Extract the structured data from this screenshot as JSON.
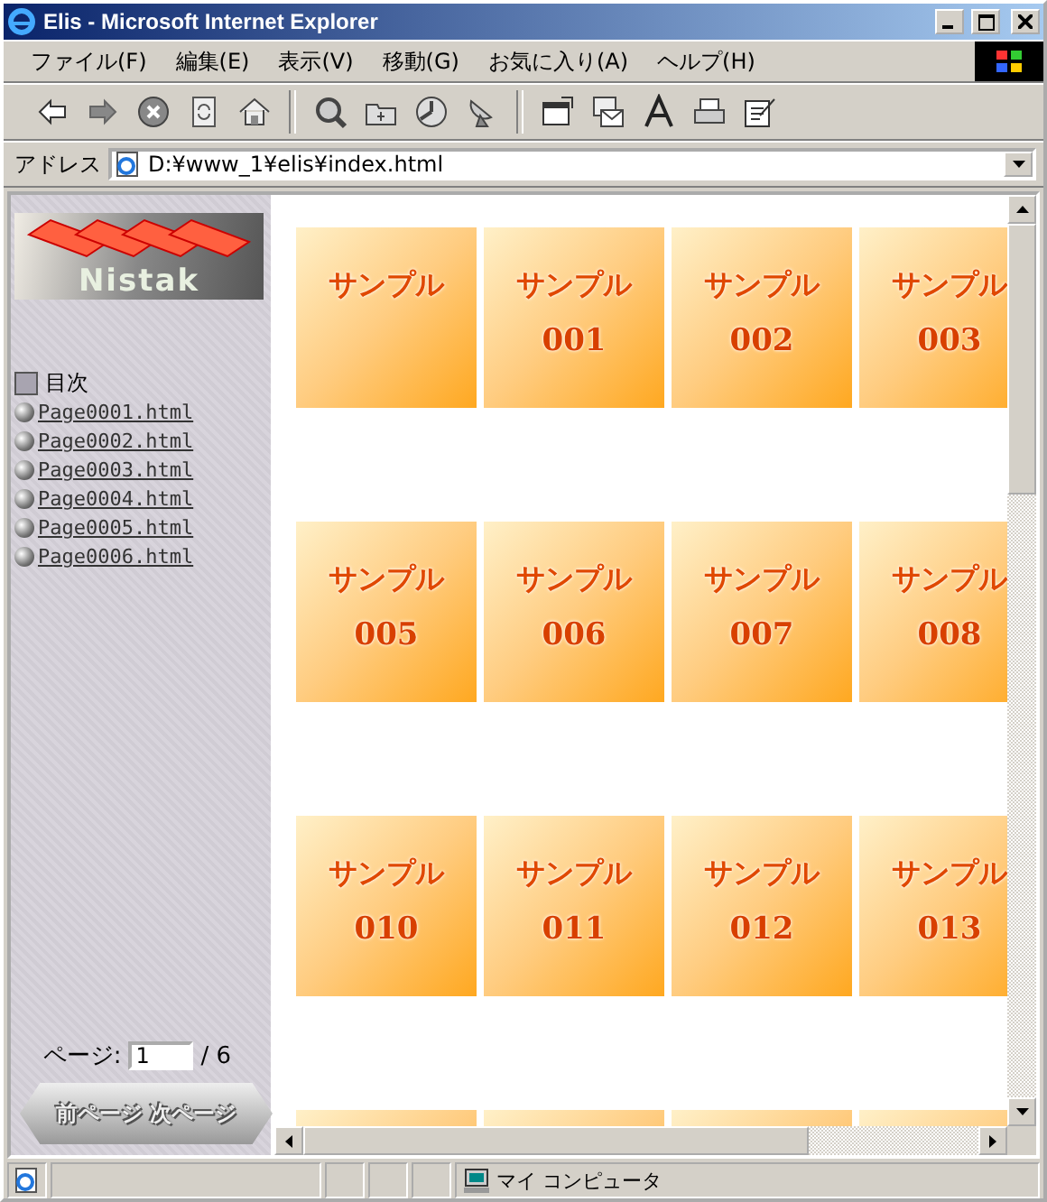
{
  "window": {
    "title": "Elis - Microsoft Internet Explorer"
  },
  "menu": [
    "ファイル(F)",
    "編集(E)",
    "表示(V)",
    "移動(G)",
    "お気に入り(A)",
    "ヘルプ(H)"
  ],
  "address": {
    "label": "アドレス",
    "value": "D:¥www_1¥elis¥index.html"
  },
  "sidebar": {
    "logo": "Nistak",
    "toc_title": "目次",
    "links": [
      "Page0001.html",
      "Page0002.html",
      "Page0003.html",
      "Page0004.html",
      "Page0005.html",
      "Page0006.html"
    ],
    "pager": {
      "label": "ページ:",
      "value": "1",
      "total": "/ 6",
      "prev": "前ページ",
      "next": "次ページ"
    }
  },
  "tiles": [
    {
      "kind": "sample",
      "title": "サンプル"
    },
    {
      "kind": "sample",
      "title": "サンプル",
      "number": "001"
    },
    {
      "kind": "sample",
      "title": "サンプル",
      "number": "002"
    },
    {
      "kind": "sample",
      "title": "サンプル",
      "number": "003"
    },
    {
      "kind": "sample",
      "title": "サンプル",
      "number": "005"
    },
    {
      "kind": "sample",
      "title": "サンプル",
      "number": "006"
    },
    {
      "kind": "sample",
      "title": "サンプル",
      "number": "007"
    },
    {
      "kind": "sample",
      "title": "サンプル",
      "number": "008"
    },
    {
      "kind": "sample",
      "title": "サンプル",
      "number": "010"
    },
    {
      "kind": "sample",
      "title": "サンプル",
      "number": "011"
    },
    {
      "kind": "sample",
      "title": "サンプル",
      "number": "012"
    },
    {
      "kind": "sample",
      "title": "サンプル",
      "number": "013"
    },
    {
      "kind": "blank"
    },
    {
      "kind": "blank"
    },
    {
      "kind": "blank"
    },
    {
      "kind": "blank"
    }
  ],
  "status_bar": {
    "zone": "マイ コンピュータ"
  }
}
